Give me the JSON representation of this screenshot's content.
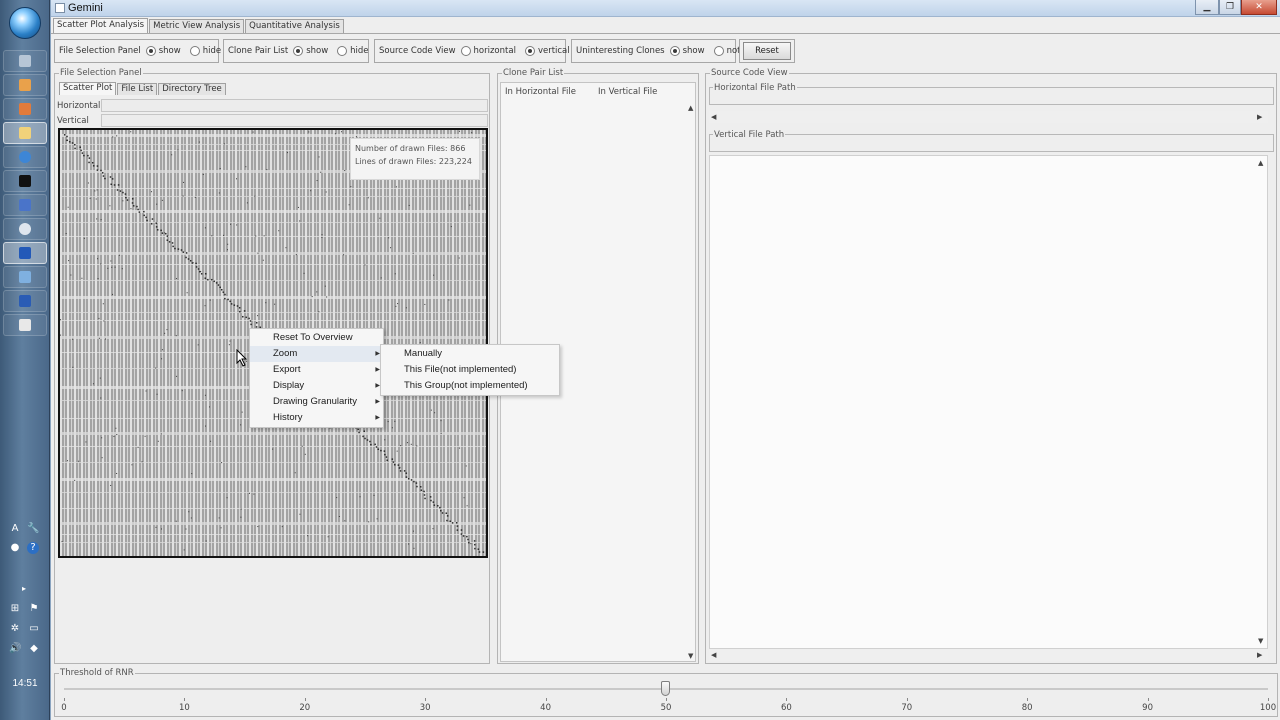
{
  "window": {
    "title": "Gemini"
  },
  "taskbar": {
    "clock": "14:51"
  },
  "main_tabs": [
    "Scatter Plot Analysis",
    "Metric View Analysis",
    "Quantitative Analysis"
  ],
  "toolbar": {
    "file_selection_panel": {
      "label": "File Selection Panel",
      "options": [
        "show",
        "hide"
      ],
      "selected": "show"
    },
    "clone_pair_list": {
      "label": "Clone Pair List",
      "options": [
        "show",
        "hide"
      ],
      "selected": "show"
    },
    "source_code_view": {
      "label": "Source Code View",
      "options": [
        "horizontal",
        "vertical"
      ],
      "selected": "vertical"
    },
    "uninteresting_clones": {
      "label": "Uninteresting Clones",
      "options": [
        "show",
        "not"
      ],
      "selected": "show"
    },
    "reset_label": "Reset"
  },
  "file_panel": {
    "title": "File Selection Panel",
    "tabs": [
      "Scatter Plot",
      "File List",
      "Directory Tree"
    ],
    "horizontal_label": "Horizontal",
    "vertical_label": "Vertical",
    "info": {
      "drawn_files": "Number of drawn Files: 866",
      "drawn_lines": "Lines of drawn Files: 223,224"
    }
  },
  "clone_panel": {
    "title": "Clone Pair List",
    "columns": [
      "In Horizontal File",
      "In Vertical File"
    ]
  },
  "source_panel": {
    "title": "Source Code View",
    "horizontal_path_label": "Horizontal File Path",
    "vertical_path_label": "Vertical File Path"
  },
  "threshold": {
    "label": "Threshold of RNR",
    "value": 50,
    "ticks": [
      "0",
      "10",
      "20",
      "30",
      "40",
      "50",
      "60",
      "70",
      "80",
      "90",
      "100"
    ]
  },
  "context_menu": {
    "items": [
      {
        "label": "Reset To Overview",
        "submenu": false
      },
      {
        "label": "Zoom",
        "submenu": true
      },
      {
        "label": "Export",
        "submenu": true
      },
      {
        "label": "Display",
        "submenu": true
      },
      {
        "label": "Drawing Granularity",
        "submenu": true
      },
      {
        "label": "History",
        "submenu": true
      }
    ],
    "zoom_submenu": [
      "Manually",
      "This File(not implemented)",
      "This Group(not implemented)"
    ]
  },
  "icons": {
    "start": "windows-start-orb-icon",
    "minimize": "minimize-icon",
    "maximize": "maximize-icon",
    "close": "close-icon"
  }
}
